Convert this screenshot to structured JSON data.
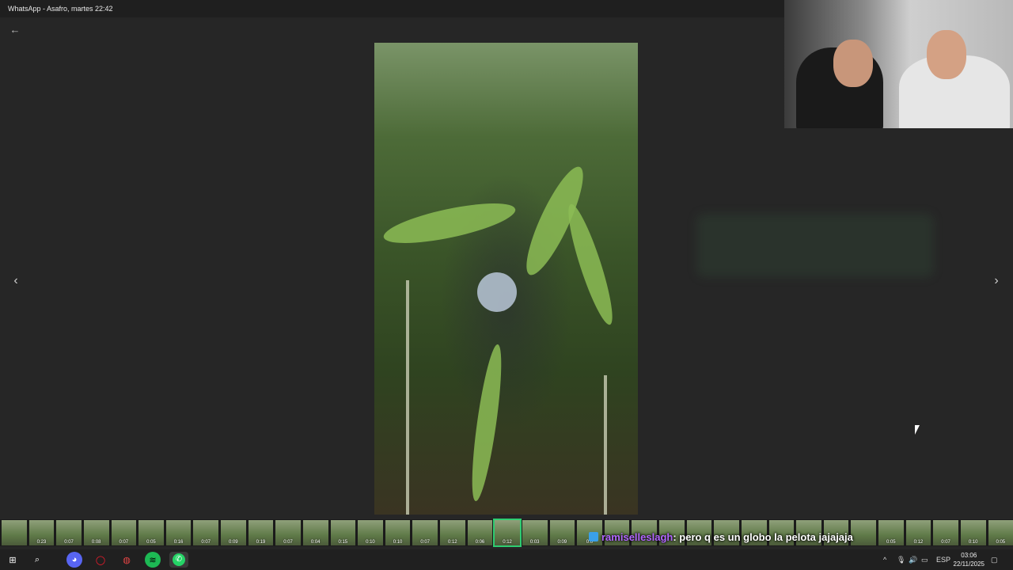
{
  "window": {
    "title": "WhatsApp - Asafro, martes 22:42"
  },
  "viewer": {
    "back_icon": "arrow-left-icon",
    "prev_icon": "chevron-left-icon",
    "next_icon": "chevron-right-icon"
  },
  "filmstrip": {
    "durations": [
      "",
      "0:23",
      "0:07",
      "0:08",
      "0:07",
      "0:05",
      "0:16",
      "0:07",
      "0:09",
      "0:19",
      "0:07",
      "0:04",
      "0:15",
      "0:10",
      "0:10",
      "0:07",
      "0:12",
      "0:06",
      "0:12",
      "0:03",
      "0:09",
      "0:0",
      "",
      "",
      "",
      "",
      "",
      "",
      "",
      "",
      "",
      "",
      "0:05",
      "0:12",
      "0:07",
      "0:10",
      "0:05"
    ],
    "active_index": 18
  },
  "chat_overlay": {
    "username": "ramiselleslagh",
    "message": ": pero q es un globo la pelota jajajaja"
  },
  "taskbar": {
    "icons": [
      "windows-start-icon",
      "search-icon",
      "discord-icon",
      "opera-icon",
      "app-icon",
      "spotify-icon",
      "whatsapp-icon"
    ],
    "tray_lang": "ESP",
    "time": "03:06",
    "date": "22/11/2025"
  },
  "colors": {
    "accent_active": "#2ecc71",
    "chat_username": "#b266ff",
    "spotify": "#1db954",
    "whatsapp": "#25d366"
  }
}
